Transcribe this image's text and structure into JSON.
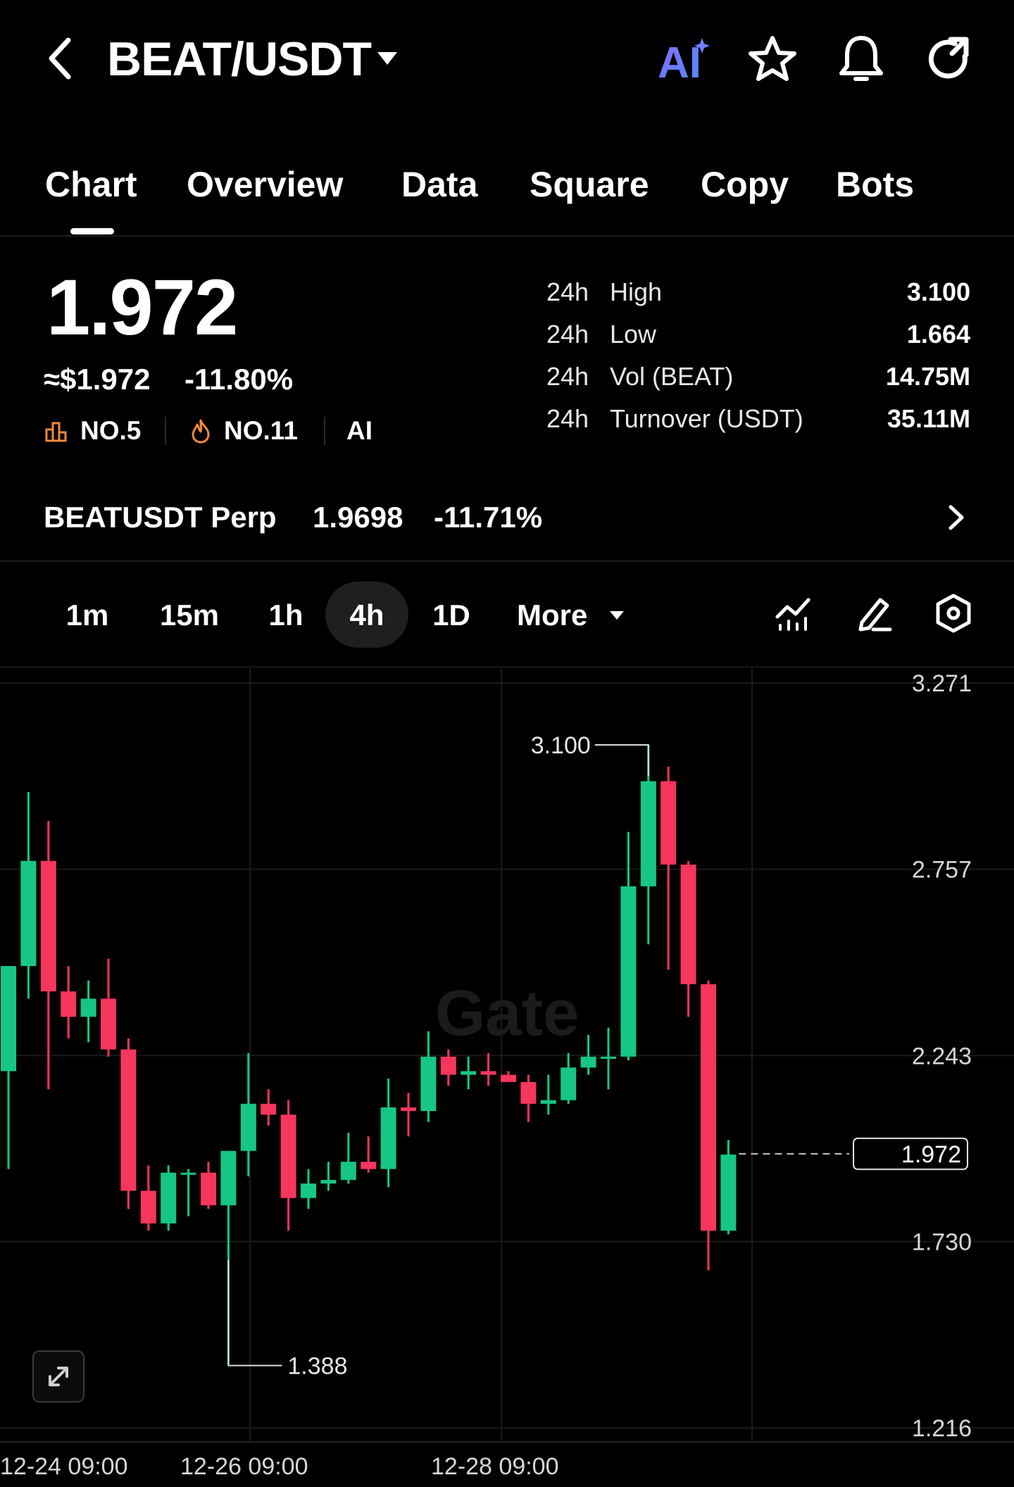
{
  "header": {
    "pair": "BEAT/USDT",
    "ai_label": "AI"
  },
  "tabs": [
    {
      "label": "Chart"
    },
    {
      "label": "Overview"
    },
    {
      "label": "Data"
    },
    {
      "label": "Square"
    },
    {
      "label": "Copy"
    },
    {
      "label": "Bots"
    }
  ],
  "ticker": {
    "price": "1.972",
    "usd_price": "≈$1.972",
    "change": "-11.80%",
    "rank_1": "NO.5",
    "rank_2": "NO.11",
    "tag": "AI"
  },
  "stats": [
    {
      "period": "24h",
      "label": "High",
      "value": "3.100"
    },
    {
      "period": "24h",
      "label": "Low",
      "value": "1.664"
    },
    {
      "period": "24h",
      "label": "Vol (BEAT)",
      "value": "14.75M"
    },
    {
      "period": "24h",
      "label": "Turnover (USDT)",
      "value": "35.11M"
    }
  ],
  "perp": {
    "name": "BEATUSDT Perp",
    "price": "1.9698",
    "change": "-11.71%"
  },
  "timeframes": {
    "items": [
      "1m",
      "15m",
      "1h",
      "4h",
      "1D"
    ],
    "selected": "4h",
    "more_label": "More"
  },
  "colors": {
    "up": "#16c784",
    "down": "#f6365d",
    "background": "#000000"
  },
  "chart_data": {
    "type": "candlestick",
    "watermark": "Gate",
    "y_ticks": [
      "3.271",
      "2.757",
      "2.243",
      "1.730",
      "1.216"
    ],
    "ylim": [
      1.216,
      3.271
    ],
    "x_ticks": [
      {
        "label": "12-24 09:00",
        "index": 1
      },
      {
        "label": "12-26 09:00",
        "index": 13
      },
      {
        "label": "12-28 09:00",
        "index": 25
      }
    ],
    "high_marker": {
      "label": "3.100",
      "value": 3.1,
      "index": 32
    },
    "low_marker": {
      "label": "1.388",
      "value": 1.388,
      "index": 11
    },
    "last_price": {
      "label": "1.972",
      "value": 1.972
    },
    "candles": [
      {
        "o": 2.2,
        "h": 2.35,
        "l": 1.93,
        "c": 2.49
      },
      {
        "o": 2.49,
        "h": 2.97,
        "l": 2.4,
        "c": 2.78
      },
      {
        "o": 2.78,
        "h": 2.89,
        "l": 2.15,
        "c": 2.42
      },
      {
        "o": 2.42,
        "h": 2.49,
        "l": 2.29,
        "c": 2.35
      },
      {
        "o": 2.35,
        "h": 2.45,
        "l": 2.28,
        "c": 2.4
      },
      {
        "o": 2.4,
        "h": 2.51,
        "l": 2.24,
        "c": 2.26
      },
      {
        "o": 2.26,
        "h": 2.29,
        "l": 1.82,
        "c": 1.87
      },
      {
        "o": 1.87,
        "h": 1.94,
        "l": 1.76,
        "c": 1.78
      },
      {
        "o": 1.78,
        "h": 1.94,
        "l": 1.76,
        "c": 1.92
      },
      {
        "o": 1.92,
        "h": 1.93,
        "l": 1.8,
        "c": 1.92
      },
      {
        "o": 1.92,
        "h": 1.95,
        "l": 1.82,
        "c": 1.83
      },
      {
        "o": 1.83,
        "h": 1.98,
        "l": 1.39,
        "c": 1.98
      },
      {
        "o": 1.98,
        "h": 2.25,
        "l": 1.91,
        "c": 2.11
      },
      {
        "o": 2.11,
        "h": 2.15,
        "l": 2.05,
        "c": 2.08
      },
      {
        "o": 2.08,
        "h": 2.12,
        "l": 1.76,
        "c": 1.85
      },
      {
        "o": 1.85,
        "h": 1.93,
        "l": 1.82,
        "c": 1.89
      },
      {
        "o": 1.89,
        "h": 1.95,
        "l": 1.87,
        "c": 1.9
      },
      {
        "o": 1.9,
        "h": 2.03,
        "l": 1.89,
        "c": 1.95
      },
      {
        "o": 1.95,
        "h": 2.02,
        "l": 1.92,
        "c": 1.93
      },
      {
        "o": 1.93,
        "h": 2.18,
        "l": 1.88,
        "c": 2.1
      },
      {
        "o": 2.1,
        "h": 2.14,
        "l": 2.02,
        "c": 2.09
      },
      {
        "o": 2.09,
        "h": 2.31,
        "l": 2.06,
        "c": 2.24
      },
      {
        "o": 2.24,
        "h": 2.26,
        "l": 2.16,
        "c": 2.19
      },
      {
        "o": 2.19,
        "h": 2.24,
        "l": 2.15,
        "c": 2.2
      },
      {
        "o": 2.2,
        "h": 2.25,
        "l": 2.16,
        "c": 2.19
      },
      {
        "o": 2.19,
        "h": 2.2,
        "l": 2.17,
        "c": 2.17
      },
      {
        "o": 2.17,
        "h": 2.19,
        "l": 2.06,
        "c": 2.11
      },
      {
        "o": 2.11,
        "h": 2.19,
        "l": 2.08,
        "c": 2.12
      },
      {
        "o": 2.12,
        "h": 2.25,
        "l": 2.11,
        "c": 2.21
      },
      {
        "o": 2.21,
        "h": 2.3,
        "l": 2.19,
        "c": 2.24
      },
      {
        "o": 2.24,
        "h": 2.32,
        "l": 2.15,
        "c": 2.24
      },
      {
        "o": 2.24,
        "h": 2.86,
        "l": 2.23,
        "c": 2.71
      },
      {
        "o": 2.71,
        "h": 3.1,
        "l": 2.55,
        "c": 3.0
      },
      {
        "o": 3.0,
        "h": 3.04,
        "l": 2.48,
        "c": 2.77
      },
      {
        "o": 2.77,
        "h": 2.78,
        "l": 2.35,
        "c": 2.44
      },
      {
        "o": 2.44,
        "h": 2.45,
        "l": 1.65,
        "c": 1.76
      },
      {
        "o": 1.76,
        "h": 2.01,
        "l": 1.75,
        "c": 1.97
      }
    ]
  }
}
